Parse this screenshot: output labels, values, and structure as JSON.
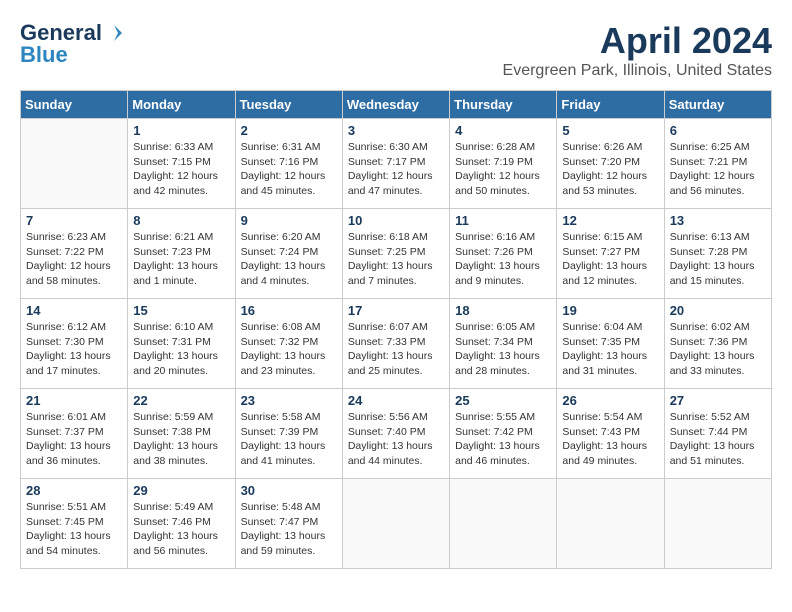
{
  "header": {
    "logo_general": "General",
    "logo_blue": "Blue",
    "month": "April 2024",
    "location": "Evergreen Park, Illinois, United States"
  },
  "days_of_week": [
    "Sunday",
    "Monday",
    "Tuesday",
    "Wednesday",
    "Thursday",
    "Friday",
    "Saturday"
  ],
  "weeks": [
    [
      {
        "day": "",
        "info": ""
      },
      {
        "day": "1",
        "info": "Sunrise: 6:33 AM\nSunset: 7:15 PM\nDaylight: 12 hours\nand 42 minutes."
      },
      {
        "day": "2",
        "info": "Sunrise: 6:31 AM\nSunset: 7:16 PM\nDaylight: 12 hours\nand 45 minutes."
      },
      {
        "day": "3",
        "info": "Sunrise: 6:30 AM\nSunset: 7:17 PM\nDaylight: 12 hours\nand 47 minutes."
      },
      {
        "day": "4",
        "info": "Sunrise: 6:28 AM\nSunset: 7:19 PM\nDaylight: 12 hours\nand 50 minutes."
      },
      {
        "day": "5",
        "info": "Sunrise: 6:26 AM\nSunset: 7:20 PM\nDaylight: 12 hours\nand 53 minutes."
      },
      {
        "day": "6",
        "info": "Sunrise: 6:25 AM\nSunset: 7:21 PM\nDaylight: 12 hours\nand 56 minutes."
      }
    ],
    [
      {
        "day": "7",
        "info": "Sunrise: 6:23 AM\nSunset: 7:22 PM\nDaylight: 12 hours\nand 58 minutes."
      },
      {
        "day": "8",
        "info": "Sunrise: 6:21 AM\nSunset: 7:23 PM\nDaylight: 13 hours\nand 1 minute."
      },
      {
        "day": "9",
        "info": "Sunrise: 6:20 AM\nSunset: 7:24 PM\nDaylight: 13 hours\nand 4 minutes."
      },
      {
        "day": "10",
        "info": "Sunrise: 6:18 AM\nSunset: 7:25 PM\nDaylight: 13 hours\nand 7 minutes."
      },
      {
        "day": "11",
        "info": "Sunrise: 6:16 AM\nSunset: 7:26 PM\nDaylight: 13 hours\nand 9 minutes."
      },
      {
        "day": "12",
        "info": "Sunrise: 6:15 AM\nSunset: 7:27 PM\nDaylight: 13 hours\nand 12 minutes."
      },
      {
        "day": "13",
        "info": "Sunrise: 6:13 AM\nSunset: 7:28 PM\nDaylight: 13 hours\nand 15 minutes."
      }
    ],
    [
      {
        "day": "14",
        "info": "Sunrise: 6:12 AM\nSunset: 7:30 PM\nDaylight: 13 hours\nand 17 minutes."
      },
      {
        "day": "15",
        "info": "Sunrise: 6:10 AM\nSunset: 7:31 PM\nDaylight: 13 hours\nand 20 minutes."
      },
      {
        "day": "16",
        "info": "Sunrise: 6:08 AM\nSunset: 7:32 PM\nDaylight: 13 hours\nand 23 minutes."
      },
      {
        "day": "17",
        "info": "Sunrise: 6:07 AM\nSunset: 7:33 PM\nDaylight: 13 hours\nand 25 minutes."
      },
      {
        "day": "18",
        "info": "Sunrise: 6:05 AM\nSunset: 7:34 PM\nDaylight: 13 hours\nand 28 minutes."
      },
      {
        "day": "19",
        "info": "Sunrise: 6:04 AM\nSunset: 7:35 PM\nDaylight: 13 hours\nand 31 minutes."
      },
      {
        "day": "20",
        "info": "Sunrise: 6:02 AM\nSunset: 7:36 PM\nDaylight: 13 hours\nand 33 minutes."
      }
    ],
    [
      {
        "day": "21",
        "info": "Sunrise: 6:01 AM\nSunset: 7:37 PM\nDaylight: 13 hours\nand 36 minutes."
      },
      {
        "day": "22",
        "info": "Sunrise: 5:59 AM\nSunset: 7:38 PM\nDaylight: 13 hours\nand 38 minutes."
      },
      {
        "day": "23",
        "info": "Sunrise: 5:58 AM\nSunset: 7:39 PM\nDaylight: 13 hours\nand 41 minutes."
      },
      {
        "day": "24",
        "info": "Sunrise: 5:56 AM\nSunset: 7:40 PM\nDaylight: 13 hours\nand 44 minutes."
      },
      {
        "day": "25",
        "info": "Sunrise: 5:55 AM\nSunset: 7:42 PM\nDaylight: 13 hours\nand 46 minutes."
      },
      {
        "day": "26",
        "info": "Sunrise: 5:54 AM\nSunset: 7:43 PM\nDaylight: 13 hours\nand 49 minutes."
      },
      {
        "day": "27",
        "info": "Sunrise: 5:52 AM\nSunset: 7:44 PM\nDaylight: 13 hours\nand 51 minutes."
      }
    ],
    [
      {
        "day": "28",
        "info": "Sunrise: 5:51 AM\nSunset: 7:45 PM\nDaylight: 13 hours\nand 54 minutes."
      },
      {
        "day": "29",
        "info": "Sunrise: 5:49 AM\nSunset: 7:46 PM\nDaylight: 13 hours\nand 56 minutes."
      },
      {
        "day": "30",
        "info": "Sunrise: 5:48 AM\nSunset: 7:47 PM\nDaylight: 13 hours\nand 59 minutes."
      },
      {
        "day": "",
        "info": ""
      },
      {
        "day": "",
        "info": ""
      },
      {
        "day": "",
        "info": ""
      },
      {
        "day": "",
        "info": ""
      }
    ]
  ]
}
